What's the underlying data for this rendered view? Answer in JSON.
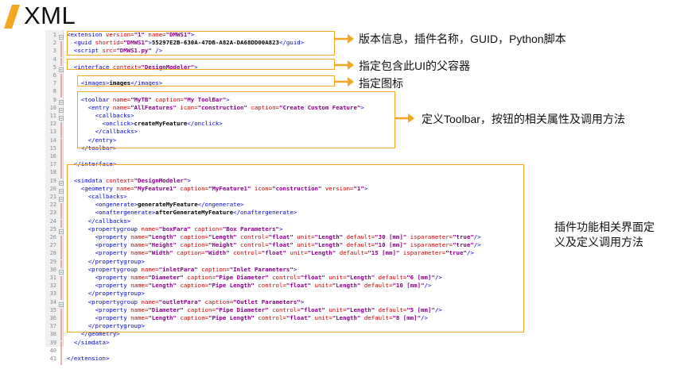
{
  "title": "XML",
  "lines": [
    {
      "n": "1",
      "parts": [
        [
          "tag",
          "<extension "
        ],
        [
          "attr",
          "version="
        ],
        [
          "val",
          "\"1\" "
        ],
        [
          "attr",
          "name="
        ],
        [
          "val",
          "\"DMWS1\""
        ],
        [
          "tag",
          ">"
        ]
      ]
    },
    {
      "n": "2",
      "parts": [
        [
          "tag",
          "  <guid "
        ],
        [
          "attr",
          "shortid="
        ],
        [
          "val",
          "\"DMWS1\""
        ],
        [
          "tag",
          ">"
        ],
        [
          "txt",
          "55297E2B-630A-47DB-A82A-DA68DD00A823"
        ],
        [
          "tag",
          "</guid>"
        ]
      ]
    },
    {
      "n": "3",
      "parts": [
        [
          "tag",
          "  <script "
        ],
        [
          "attr",
          "src="
        ],
        [
          "val",
          "\"DMWS1.py\" "
        ],
        [
          "tag",
          "/>"
        ]
      ]
    },
    {
      "n": "4",
      "parts": []
    },
    {
      "n": "5",
      "parts": [
        [
          "tag",
          "  <interface "
        ],
        [
          "attr",
          "context="
        ],
        [
          "val",
          "\"DesignModeler\""
        ],
        [
          "tag",
          ">"
        ]
      ]
    },
    {
      "n": "6",
      "parts": []
    },
    {
      "n": "7",
      "parts": [
        [
          "tag",
          "    <images>"
        ],
        [
          "txt",
          "images"
        ],
        [
          "tag",
          "</images>"
        ]
      ]
    },
    {
      "n": "8",
      "parts": []
    },
    {
      "n": "9",
      "parts": [
        [
          "tag",
          "    <toolbar "
        ],
        [
          "attr",
          "name="
        ],
        [
          "val",
          "\"MyTB\" "
        ],
        [
          "attr",
          "caption="
        ],
        [
          "val",
          "\"My ToolBar\""
        ],
        [
          "tag",
          ">"
        ]
      ]
    },
    {
      "n": "10",
      "parts": [
        [
          "tag",
          "      <entry "
        ],
        [
          "attr",
          "name="
        ],
        [
          "val",
          "\"AllFeatures\" "
        ],
        [
          "attr",
          "icon="
        ],
        [
          "val",
          "\"construction\" "
        ],
        [
          "attr",
          "caption="
        ],
        [
          "val",
          "\"Create Custom Feature\""
        ],
        [
          "tag",
          ">"
        ]
      ]
    },
    {
      "n": "11",
      "parts": [
        [
          "tag",
          "        <callbacks>"
        ]
      ]
    },
    {
      "n": "12",
      "parts": [
        [
          "tag",
          "          <onclick>"
        ],
        [
          "txt",
          "createMyFeature"
        ],
        [
          "tag",
          "</onclick>"
        ]
      ]
    },
    {
      "n": "13",
      "parts": [
        [
          "tag",
          "        </callbacks>"
        ]
      ]
    },
    {
      "n": "14",
      "parts": [
        [
          "tag",
          "      </entry>"
        ]
      ]
    },
    {
      "n": "15",
      "parts": [
        [
          "tag",
          "    </toolbar>"
        ]
      ]
    },
    {
      "n": "16",
      "parts": []
    },
    {
      "n": "17",
      "parts": [
        [
          "tag",
          "  </interface>"
        ]
      ]
    },
    {
      "n": "18",
      "parts": []
    },
    {
      "n": "19",
      "parts": [
        [
          "tag",
          "  <simdata "
        ],
        [
          "attr",
          "context="
        ],
        [
          "val",
          "\"DesignModeler\""
        ],
        [
          "tag",
          ">"
        ]
      ]
    },
    {
      "n": "20",
      "parts": [
        [
          "tag",
          "    <geometry "
        ],
        [
          "attr",
          "name="
        ],
        [
          "val",
          "\"MyFeature1\" "
        ],
        [
          "attr",
          "caption="
        ],
        [
          "val",
          "\"MyFeature1\" "
        ],
        [
          "attr",
          "icon="
        ],
        [
          "val",
          "\"construction\" "
        ],
        [
          "attr",
          "version="
        ],
        [
          "val",
          "\"1\""
        ],
        [
          "tag",
          ">"
        ]
      ]
    },
    {
      "n": "21",
      "parts": [
        [
          "tag",
          "      <callbacks>"
        ]
      ]
    },
    {
      "n": "22",
      "parts": [
        [
          "tag",
          "        <ongenerate>"
        ],
        [
          "txt",
          "generateMyFeature"
        ],
        [
          "tag",
          "</ongenerate>"
        ]
      ]
    },
    {
      "n": "23",
      "parts": [
        [
          "tag",
          "        <onaftergenerate>"
        ],
        [
          "txt",
          "afterGenerateMyFeature"
        ],
        [
          "tag",
          "</onaftergenerate>"
        ]
      ]
    },
    {
      "n": "24",
      "parts": [
        [
          "tag",
          "      </callbacks>"
        ]
      ]
    },
    {
      "n": "25",
      "parts": [
        [
          "tag",
          "      <propertygroup "
        ],
        [
          "attr",
          "name="
        ],
        [
          "val",
          "\"boxPara\" "
        ],
        [
          "attr",
          "caption="
        ],
        [
          "val",
          "\"Box Parameters\""
        ],
        [
          "tag",
          ">"
        ]
      ]
    },
    {
      "n": "26",
      "parts": [
        [
          "tag",
          "        <property "
        ],
        [
          "attr",
          "name="
        ],
        [
          "val",
          "\"Length\" "
        ],
        [
          "attr",
          "caption="
        ],
        [
          "val",
          "\"Length\" "
        ],
        [
          "attr",
          "control="
        ],
        [
          "val",
          "\"float\" "
        ],
        [
          "attr",
          "unit="
        ],
        [
          "val",
          "\"Length\" "
        ],
        [
          "attr",
          "default="
        ],
        [
          "val",
          "\"30 [mm]\" "
        ],
        [
          "attr",
          "isparameter="
        ],
        [
          "val",
          "\"true\""
        ],
        [
          "tag",
          "/>"
        ]
      ]
    },
    {
      "n": "27",
      "parts": [
        [
          "tag",
          "        <property "
        ],
        [
          "attr",
          "name="
        ],
        [
          "val",
          "\"Height\" "
        ],
        [
          "attr",
          "caption="
        ],
        [
          "val",
          "\"Height\" "
        ],
        [
          "attr",
          "control="
        ],
        [
          "val",
          "\"float\" "
        ],
        [
          "attr",
          "unit="
        ],
        [
          "val",
          "\"Length\" "
        ],
        [
          "attr",
          "default="
        ],
        [
          "val",
          "\"10 [mm]\" "
        ],
        [
          "attr",
          "isparameter="
        ],
        [
          "val",
          "\"true\""
        ],
        [
          "tag",
          "/>"
        ]
      ]
    },
    {
      "n": "28",
      "parts": [
        [
          "tag",
          "        <property "
        ],
        [
          "attr",
          "name="
        ],
        [
          "val",
          "\"Width\" "
        ],
        [
          "attr",
          "caption="
        ],
        [
          "val",
          "\"Width\" "
        ],
        [
          "attr",
          "control="
        ],
        [
          "val",
          "\"float\" "
        ],
        [
          "attr",
          "unit="
        ],
        [
          "val",
          "\"Length\" "
        ],
        [
          "attr",
          "default="
        ],
        [
          "val",
          "\"15 [mm]\" "
        ],
        [
          "attr",
          "isparameter="
        ],
        [
          "val",
          "\"true\""
        ],
        [
          "tag",
          "/>"
        ]
      ]
    },
    {
      "n": "29",
      "parts": [
        [
          "tag",
          "      </propertygroup>"
        ]
      ]
    },
    {
      "n": "30",
      "parts": [
        [
          "tag",
          "      <propertygroup "
        ],
        [
          "attr",
          "name="
        ],
        [
          "val",
          "\"inletPara\" "
        ],
        [
          "attr",
          "caption="
        ],
        [
          "val",
          "\"Inlet Parameters\""
        ],
        [
          "tag",
          ">"
        ]
      ]
    },
    {
      "n": "31",
      "parts": [
        [
          "tag",
          "        <property "
        ],
        [
          "attr",
          "name="
        ],
        [
          "val",
          "\"Diameter\" "
        ],
        [
          "attr",
          "caption="
        ],
        [
          "val",
          "\"Pipe Diameter\" "
        ],
        [
          "attr",
          "control="
        ],
        [
          "val",
          "\"float\" "
        ],
        [
          "attr",
          "unit="
        ],
        [
          "val",
          "\"Length\" "
        ],
        [
          "attr",
          "default="
        ],
        [
          "val",
          "\"6 [mm]\""
        ],
        [
          "tag",
          "/>"
        ]
      ]
    },
    {
      "n": "32",
      "parts": [
        [
          "tag",
          "        <property "
        ],
        [
          "attr",
          "name="
        ],
        [
          "val",
          "\"Length\" "
        ],
        [
          "attr",
          "caption="
        ],
        [
          "val",
          "\"Pipe Length\" "
        ],
        [
          "attr",
          "control="
        ],
        [
          "val",
          "\"float\" "
        ],
        [
          "attr",
          "unit="
        ],
        [
          "val",
          "\"Length\" "
        ],
        [
          "attr",
          "default="
        ],
        [
          "val",
          "\"10 [mm]\""
        ],
        [
          "tag",
          "/>"
        ]
      ]
    },
    {
      "n": "33",
      "parts": [
        [
          "tag",
          "      </propertygroup>"
        ]
      ]
    },
    {
      "n": "34",
      "parts": [
        [
          "tag",
          "      <propertygroup "
        ],
        [
          "attr",
          "name="
        ],
        [
          "val",
          "\"outletPara\" "
        ],
        [
          "attr",
          "caption="
        ],
        [
          "val",
          "\"Outlet Parameters\""
        ],
        [
          "tag",
          ">"
        ]
      ]
    },
    {
      "n": "35",
      "parts": [
        [
          "tag",
          "        <property "
        ],
        [
          "attr",
          "name="
        ],
        [
          "val",
          "\"Diameter\" "
        ],
        [
          "attr",
          "caption="
        ],
        [
          "val",
          "\"Pipe Diameter\" "
        ],
        [
          "attr",
          "control="
        ],
        [
          "val",
          "\"float\" "
        ],
        [
          "attr",
          "unit="
        ],
        [
          "val",
          "\"Length\" "
        ],
        [
          "attr",
          "default="
        ],
        [
          "val",
          "\"5 [mm]\""
        ],
        [
          "tag",
          "/>"
        ]
      ]
    },
    {
      "n": "36",
      "parts": [
        [
          "tag",
          "        <property "
        ],
        [
          "attr",
          "name="
        ],
        [
          "val",
          "\"Length\" "
        ],
        [
          "attr",
          "caption="
        ],
        [
          "val",
          "\"Pipe Length\" "
        ],
        [
          "attr",
          "control="
        ],
        [
          "val",
          "\"float\" "
        ],
        [
          "attr",
          "unit="
        ],
        [
          "val",
          "\"Length\" "
        ],
        [
          "attr",
          "default="
        ],
        [
          "val",
          "\"8 [mm]\""
        ],
        [
          "tag",
          "/>"
        ]
      ]
    },
    {
      "n": "37",
      "parts": [
        [
          "tag",
          "      </propertygroup>"
        ]
      ]
    },
    {
      "n": "38",
      "parts": [
        [
          "tag",
          "    </geometry>"
        ]
      ]
    },
    {
      "n": "39",
      "parts": [
        [
          "tag",
          "  </simdata>"
        ]
      ]
    },
    {
      "n": "40",
      "parts": []
    },
    {
      "n": "41",
      "parts": [
        [
          "tag",
          "</extension>"
        ]
      ]
    }
  ],
  "annotations": {
    "version_info": "版本信息，插件名称，GUID，Python脚本",
    "parent_container": "指定包含此UI的父容器",
    "icon": "指定图标",
    "toolbar": "定义Toolbar，按钮的相关属性及调用方法",
    "feature_line1": "插件功能相关界面定",
    "feature_line2": "义及定义调用方法"
  },
  "colors": {
    "accent": "#f5a623",
    "tag": "#0000cc",
    "attribute": "#cc0000",
    "value": "#8b008b"
  }
}
